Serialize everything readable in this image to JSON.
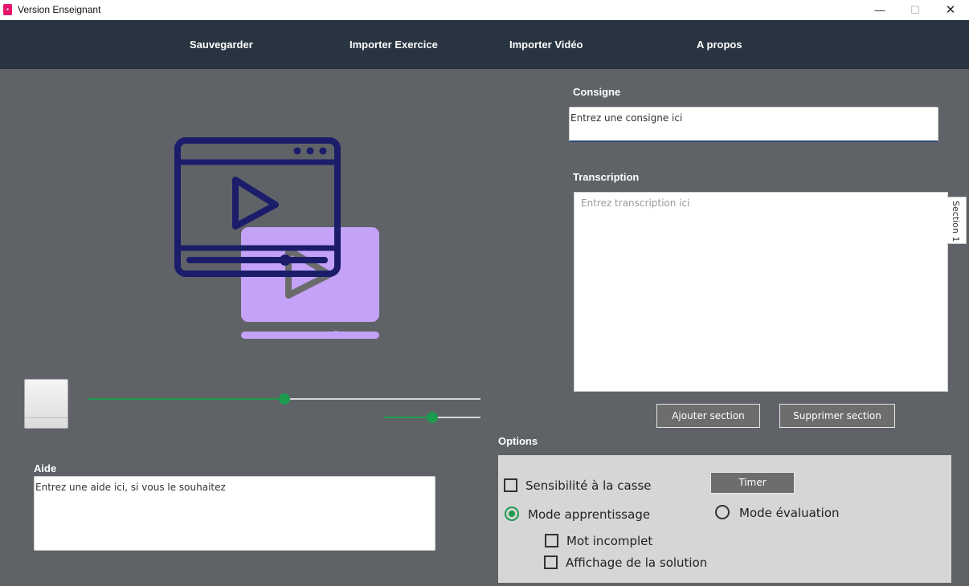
{
  "window": {
    "title": "Version Enseignant",
    "controls": {
      "minimize": "—",
      "maximize": "☐",
      "close": "✕"
    }
  },
  "menu": {
    "items": [
      {
        "label": "Sauvegarder"
      },
      {
        "label": "Importer Exercice"
      },
      {
        "label": "Importer Vidéo"
      },
      {
        "label": "A propos"
      }
    ]
  },
  "player": {
    "illustration_icon": "video-player-icon",
    "progress": 0.5,
    "volume": 0.5
  },
  "consigne": {
    "label": "Consigne",
    "value": "Entrez une consigne ici"
  },
  "transcription": {
    "label": "Transcription",
    "placeholder": "Entrez transcription ici",
    "tab_label": "Section 1"
  },
  "buttons": {
    "add_section": "Ajouter section",
    "remove_section": "Supprimer section",
    "timer": "Timer"
  },
  "aide": {
    "label": "Aide",
    "value": "Entrez une aide ici, si vous le souhaitez"
  },
  "options": {
    "label": "Options",
    "case_sensitivity": {
      "label": "Sensibilité  à la casse",
      "checked": false
    },
    "learning_mode": {
      "label": "Mode apprentissage",
      "selected": true
    },
    "evaluation_mode": {
      "label": "Mode évaluation",
      "selected": false
    },
    "incomplete_word": {
      "label": "Mot incomplet",
      "checked": false
    },
    "show_solution": {
      "label": "Affichage de la solution",
      "checked": false
    }
  },
  "colors": {
    "background": "#5f6367",
    "menubar": "#283541",
    "accent_green": "#1e9a4e",
    "icon_navy": "#1b1d6b",
    "icon_lavender": "#c4a2f7"
  }
}
